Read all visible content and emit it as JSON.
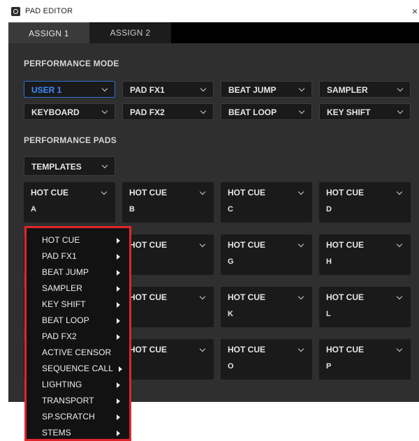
{
  "window": {
    "title": "PAD EDITOR",
    "close_glyph": "×"
  },
  "tabs": [
    {
      "label": "ASSIGN 1",
      "active": true
    },
    {
      "label": "ASSIGN 2",
      "active": false
    }
  ],
  "performance_mode": {
    "title": "PERFORMANCE MODE",
    "dropdowns": [
      {
        "label": "USER 1",
        "selected": true
      },
      {
        "label": "PAD FX1",
        "selected": false
      },
      {
        "label": "BEAT JUMP",
        "selected": false
      },
      {
        "label": "SAMPLER",
        "selected": false
      },
      {
        "label": "KEYBOARD",
        "selected": false
      },
      {
        "label": "PAD FX2",
        "selected": false
      },
      {
        "label": "BEAT LOOP",
        "selected": false
      },
      {
        "label": "KEY SHIFT",
        "selected": false
      }
    ]
  },
  "performance_pads": {
    "title": "PERFORMANCE PADS",
    "templates_label": "TEMPLATES",
    "pads": [
      {
        "type": "HOT CUE",
        "letter": "A"
      },
      {
        "type": "HOT CUE",
        "letter": "B"
      },
      {
        "type": "HOT CUE",
        "letter": "C"
      },
      {
        "type": "HOT CUE",
        "letter": "D"
      },
      {
        "type": "HOT CUE",
        "letter": ""
      },
      {
        "type": "HOT CUE",
        "letter": ""
      },
      {
        "type": "HOT CUE",
        "letter": "G"
      },
      {
        "type": "HOT CUE",
        "letter": "H"
      },
      {
        "type": "HOT CUE",
        "letter": ""
      },
      {
        "type": "HOT CUE",
        "letter": ""
      },
      {
        "type": "HOT CUE",
        "letter": "K"
      },
      {
        "type": "HOT CUE",
        "letter": "L"
      },
      {
        "type": "HOT CUE",
        "letter": ""
      },
      {
        "type": "HOT CUE",
        "letter": ""
      },
      {
        "type": "HOT CUE",
        "letter": "O"
      },
      {
        "type": "HOT CUE",
        "letter": "P"
      }
    ]
  },
  "context_menu": {
    "highlight_color": "#e0262a",
    "items": [
      {
        "label": "HOT CUE",
        "submenu": true
      },
      {
        "label": "PAD FX1",
        "submenu": true
      },
      {
        "label": "BEAT JUMP",
        "submenu": true
      },
      {
        "label": "SAMPLER",
        "submenu": true
      },
      {
        "label": "KEY SHIFT",
        "submenu": true
      },
      {
        "label": "BEAT LOOP",
        "submenu": true
      },
      {
        "label": "PAD FX2",
        "submenu": true
      },
      {
        "label": "ACTIVE CENSOR",
        "submenu": false
      },
      {
        "label": "SEQUENCE CALL",
        "submenu": true
      },
      {
        "label": "LIGHTING",
        "submenu": true
      },
      {
        "label": "TRANSPORT",
        "submenu": true
      },
      {
        "label": "SP.SCRATCH",
        "submenu": true
      },
      {
        "label": "STEMS",
        "submenu": true
      }
    ]
  },
  "colors": {
    "accent_selected": "#3b8cff",
    "panel_bg": "#2f2f2f",
    "control_bg": "#1a1a1a"
  }
}
